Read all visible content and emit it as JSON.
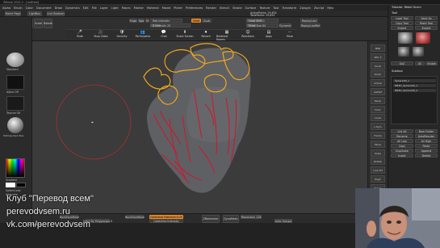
{
  "window": {
    "title": "ZBrush 2021.1 - [untitled]"
  },
  "menubar": {
    "items": [
      "Alpha",
      "Brush",
      "Color",
      "Document",
      "Draw",
      "Dynamics",
      "Edit",
      "File",
      "Layer",
      "Light",
      "Macro",
      "Marker",
      "Material",
      "Movie",
      "Picker",
      "Preferences",
      "Render",
      "Stencil",
      "Stroke",
      "Surface",
      "Texture",
      "Tool",
      "Transform",
      "Zplugin",
      "Zscript",
      "Help"
    ]
  },
  "toolbar": {
    "home_page": "Home Page",
    "lightbox": "LightBox",
    "live_boolean": "Live Boolean",
    "edit": "Edit",
    "draw": "Draw",
    "move": "Move",
    "scale": "Scale",
    "rotate": "Rotate",
    "mrgb": "Mrgb",
    "rgb": "Rgb",
    "m": "M",
    "zadd": "Zadd",
    "zsub": "Zsub",
    "rgb_intensity": "Rgb Intensity",
    "z_intensity": "Z Intensity 25",
    "focal_shift": "Focal Shift 0",
    "draw_size": "Draw Size 64",
    "dynamic": "Dynamic",
    "active_points": "ActivePoints: 29,654",
    "total_points": "TotalPoints: 29,654",
    "replay_last": "ReplayLast",
    "replay_last_rel": "ReplayLastRel"
  },
  "notifications": {
    "items": [
      {
        "label": "Mute",
        "icon": "mute-icon"
      },
      {
        "label": "Stop Video",
        "icon": "video-icon"
      },
      {
        "label": "Security",
        "icon": "shield-icon"
      },
      {
        "label": "Participants",
        "icon": "people-icon"
      },
      {
        "label": "Chat",
        "icon": "chat-icon"
      },
      {
        "label": "Share Screen",
        "icon": "share-screen-icon"
      },
      {
        "label": "Record",
        "icon": "record-icon"
      },
      {
        "label": "Breakout Rooms",
        "icon": "rooms-icon"
      },
      {
        "label": "Reactions",
        "icon": "reactions-icon"
      },
      {
        "label": "Apps",
        "icon": "apps-icon"
      },
      {
        "label": "More",
        "icon": "more-icon"
      }
    ]
  },
  "left_panel": {
    "brush_label": "Standard",
    "alpha_label": "Alpha Off",
    "texture_label": "Texture Off",
    "material_label": "MatCap Red Wax",
    "gradient": "Gradient",
    "switch_color": "SwitchColor",
    "alternate": "Alternate"
  },
  "right_shelf": {
    "items": [
      "BPR",
      "SPix 3",
      "Scroll",
      "Zoom",
      "Actual",
      "AAHalf",
      "Persp",
      "Floor",
      "Local",
      "L.Sym",
      "Frame",
      "Move",
      "Scale",
      "Rotate",
      "Line Fill",
      "PolyF",
      "Transp",
      "Ghost",
      "Solo"
    ]
  },
  "right_panel": {
    "title": "Tutorial: Rebel Scum",
    "tool_header": "Tool",
    "load_tool": "Load Tool",
    "save_as": "Save As",
    "copy_tool": "Copy Tool",
    "paste_tool": "Paste Tool",
    "import": "Import",
    "export": "Export",
    "clone": "Clone",
    "make_polymesh": "Make PolyMesh3D",
    "goz": "GoZ",
    "all": "All",
    "visible": "Visible",
    "r": "R",
    "subtool_header": "Subtool",
    "subtools": [
      "Sphere3D_1",
      "PM3D_Sphere3D_1",
      "PM3D_Sphere3D_2"
    ],
    "list_all": "List All",
    "new_folder": "New Folder",
    "rename": "Rename",
    "auto_reorder": "AutoReorder",
    "all_low": "All Low",
    "all_high": "All High",
    "copy": "Copy",
    "paste": "Paste",
    "duplicate": "Duplicate",
    "append": "Append",
    "insert": "Insert",
    "delete": "Delete"
  },
  "bottom_bar": {
    "lazy_mouse": "LazyMouse",
    "back_face_mask": "BackFaceMask",
    "mask_by_polygroups": "Mask By Polygroups 0",
    "backface_mask_b": "BackFaceMask",
    "collective_distance": "Collective Distance 0.25",
    "collective_intensity": "Collective Intensity",
    "zremesher": "ZRemesher",
    "dynamesh": "DynaMesh",
    "resolution": "Resolution 128",
    "auto_groups": "Auto Groups"
  },
  "watermark": {
    "line1": "Клуб \"Перевод всем\"",
    "line2": "perevodvsem.ru",
    "line3": "vk.com/perevodvsem"
  },
  "colors": {
    "accent_orange": "#d37a1d",
    "yellow_stroke": "#f0a81c",
    "red_stroke": "#d4142a",
    "viewport_bg": "#3b3b3b"
  }
}
